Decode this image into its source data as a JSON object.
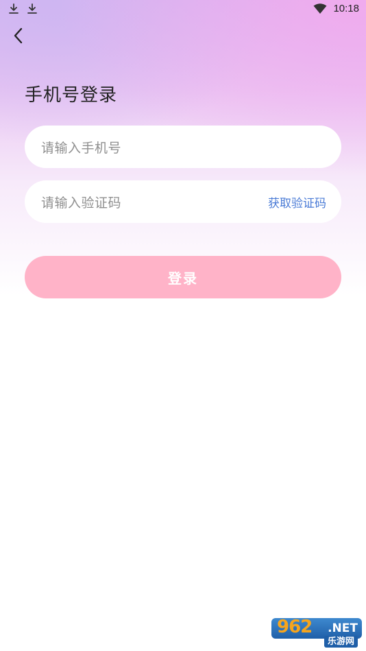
{
  "status_bar": {
    "time": "10:18",
    "icons": [
      "download-icon",
      "download-icon",
      "wifi-icon"
    ]
  },
  "nav": {
    "back_icon": "chevron-left-icon"
  },
  "page": {
    "title": "手机号登录"
  },
  "form": {
    "phone_placeholder": "请输入手机号",
    "code_placeholder": "请输入验证码",
    "get_code_label": "获取验证码",
    "login_label": "登录"
  },
  "watermark": {
    "logo_number": "962",
    "logo_suffix": ".NET",
    "site_name": "乐游网"
  },
  "colors": {
    "accent_link": "#4a7bd6",
    "login_button": "#ffb3c8",
    "title_text": "#222222",
    "placeholder_text": "#8f8f8f"
  }
}
